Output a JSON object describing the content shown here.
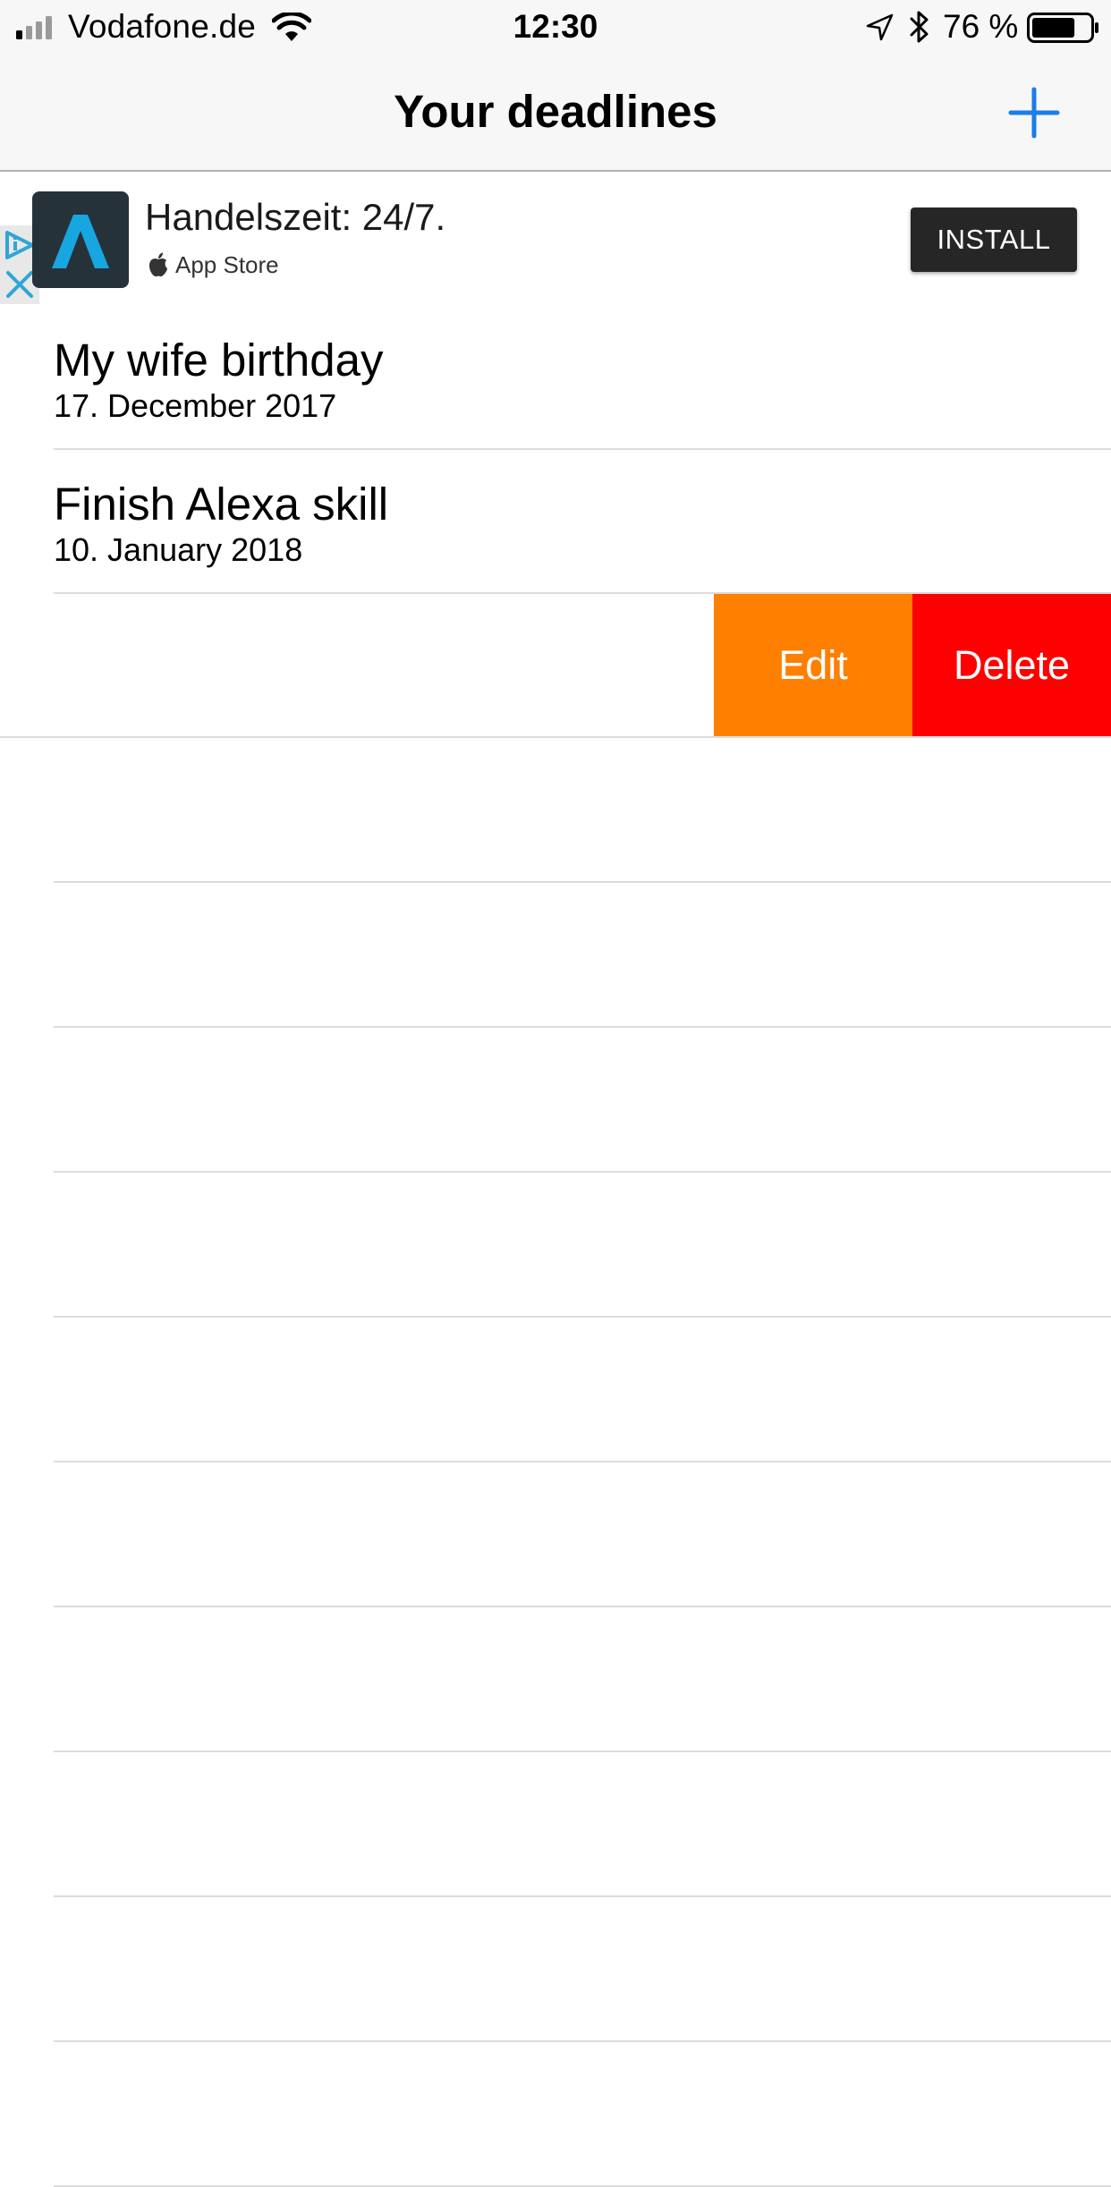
{
  "status_bar": {
    "carrier": "Vodafone.de",
    "time": "12:30",
    "battery_percent": "76 %",
    "battery_level": 0.76
  },
  "nav": {
    "title": "Your deadlines",
    "accent_color": "#1a7ee6"
  },
  "ad": {
    "headline": "Handelszeit: 24/7.",
    "store_label": "App Store",
    "install_label": "INSTALL"
  },
  "deadlines": [
    {
      "title": "My wife birthday",
      "date": "17. December 2017"
    },
    {
      "title": "Finish Alexa skill",
      "date": "10. January 2018"
    }
  ],
  "swipe_actions": {
    "edit_label": "Edit",
    "delete_label": "Delete",
    "edit_color": "#ff7f00",
    "delete_color": "#ff0000"
  }
}
